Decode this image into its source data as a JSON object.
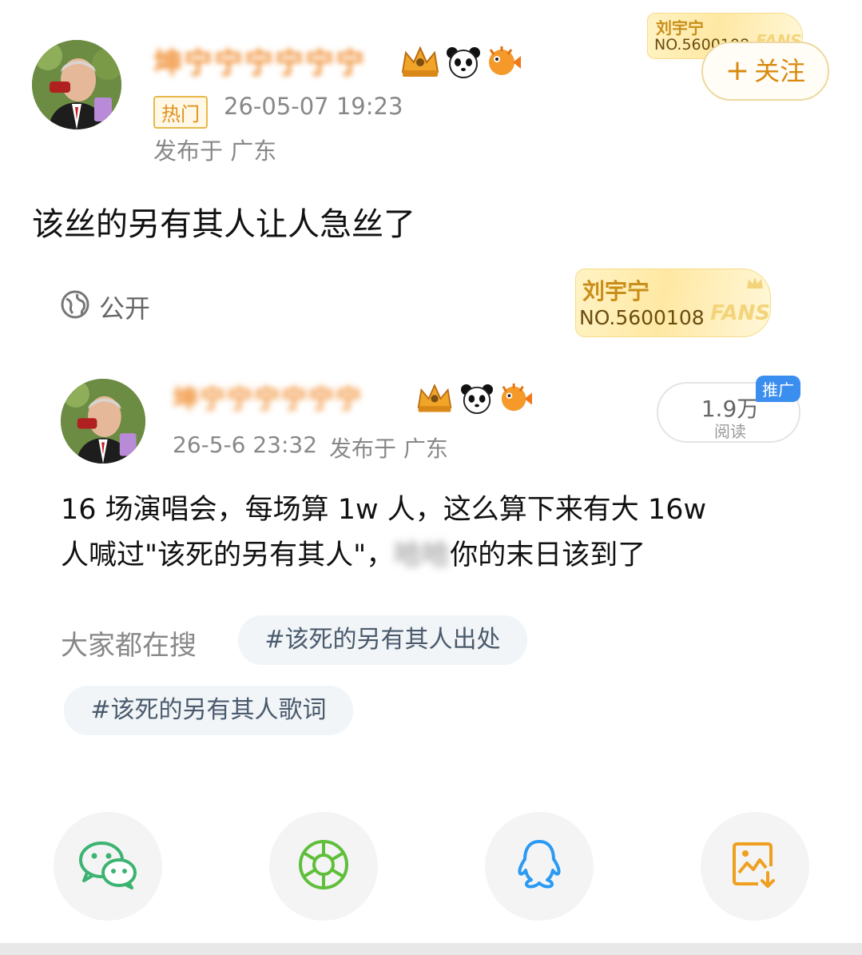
{
  "post": {
    "username": "坤宁宁宁宁宁宁",
    "hot_tag": "热门",
    "timestamp": "26-05-07 19:23",
    "location": "发布于 广东",
    "follow_label": "关注",
    "text": "该丝的另有其人让人急丝了",
    "visibility": "公开"
  },
  "fans_badge": {
    "name": "刘宇宁",
    "number": "NO.5600108",
    "watermark": "FANS"
  },
  "fans_badge_top": {
    "name": "刘宇宁",
    "number": "NO.5600108",
    "watermark": "FANS"
  },
  "repost": {
    "username": "坤宁宁宁宁宁宁",
    "timestamp": "26-5-6 23:32",
    "location": "发布于 广东",
    "reads": "1.9万",
    "reads_label": "阅读",
    "promo_label": "推广",
    "text_line1": "16 场演唱会，每场算 1w 人，这么算下来有大 16w",
    "text_line2_before": "人喊过\"该死的另有其人\"，",
    "text_line2_masked": "哈哈",
    "text_line2_after": "你的末日该到了"
  },
  "search": {
    "label": "大家都在搜",
    "topics": [
      "#该死的另有其人出处",
      "#该死的另有其人歌词"
    ]
  },
  "share": {
    "icons": [
      "wechat-icon",
      "moments-icon",
      "qq-icon",
      "save-image-icon"
    ],
    "colors": {
      "wechat": "#3cb371",
      "moments": "#5fbf3a",
      "qq": "#2b9af3",
      "save": "#f0a020"
    }
  }
}
